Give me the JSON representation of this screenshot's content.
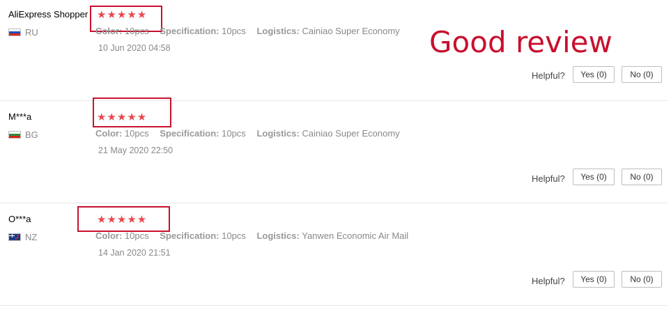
{
  "annotation": "Good review",
  "colors": {
    "star": "#e8484d",
    "highlight": "#c8102e",
    "annotation": "#c8102e"
  },
  "helpful_label": "Helpful?",
  "reviews": [
    {
      "user": "AliExpress Shopper",
      "country": "RU",
      "flag": "russia-flag-icon",
      "rating": 5,
      "stars": "★★★★★",
      "color_label": "Color:",
      "color_value": "10pcs",
      "spec_label": "Specification:",
      "spec_value": "10pcs",
      "logistics_label": "Logistics:",
      "logistics_value": "Cainiao Super Economy",
      "date": "10 Jun 2020 04:58",
      "yes": "Yes (0)",
      "no": "No (0)"
    },
    {
      "user": "M***a",
      "country": "BG",
      "flag": "bulgaria-flag-icon",
      "rating": 5,
      "stars": "★★★★★",
      "color_label": "Color:",
      "color_value": "10pcs",
      "spec_label": "Specification:",
      "spec_value": "10pcs",
      "logistics_label": "Logistics:",
      "logistics_value": "Cainiao Super Economy",
      "date": "21 May 2020 22:50",
      "yes": "Yes (0)",
      "no": "No (0)"
    },
    {
      "user": "O***a",
      "country": "NZ",
      "flag": "new-zealand-flag-icon",
      "rating": 5,
      "stars": "★★★★★",
      "color_label": "Color:",
      "color_value": "10pcs",
      "spec_label": "Specification:",
      "spec_value": "10pcs",
      "logistics_label": "Logistics:",
      "logistics_value": "Yanwen Economic Air Mail",
      "date": "14 Jan 2020 21:51",
      "yes": "Yes (0)",
      "no": "No (0)"
    }
  ]
}
